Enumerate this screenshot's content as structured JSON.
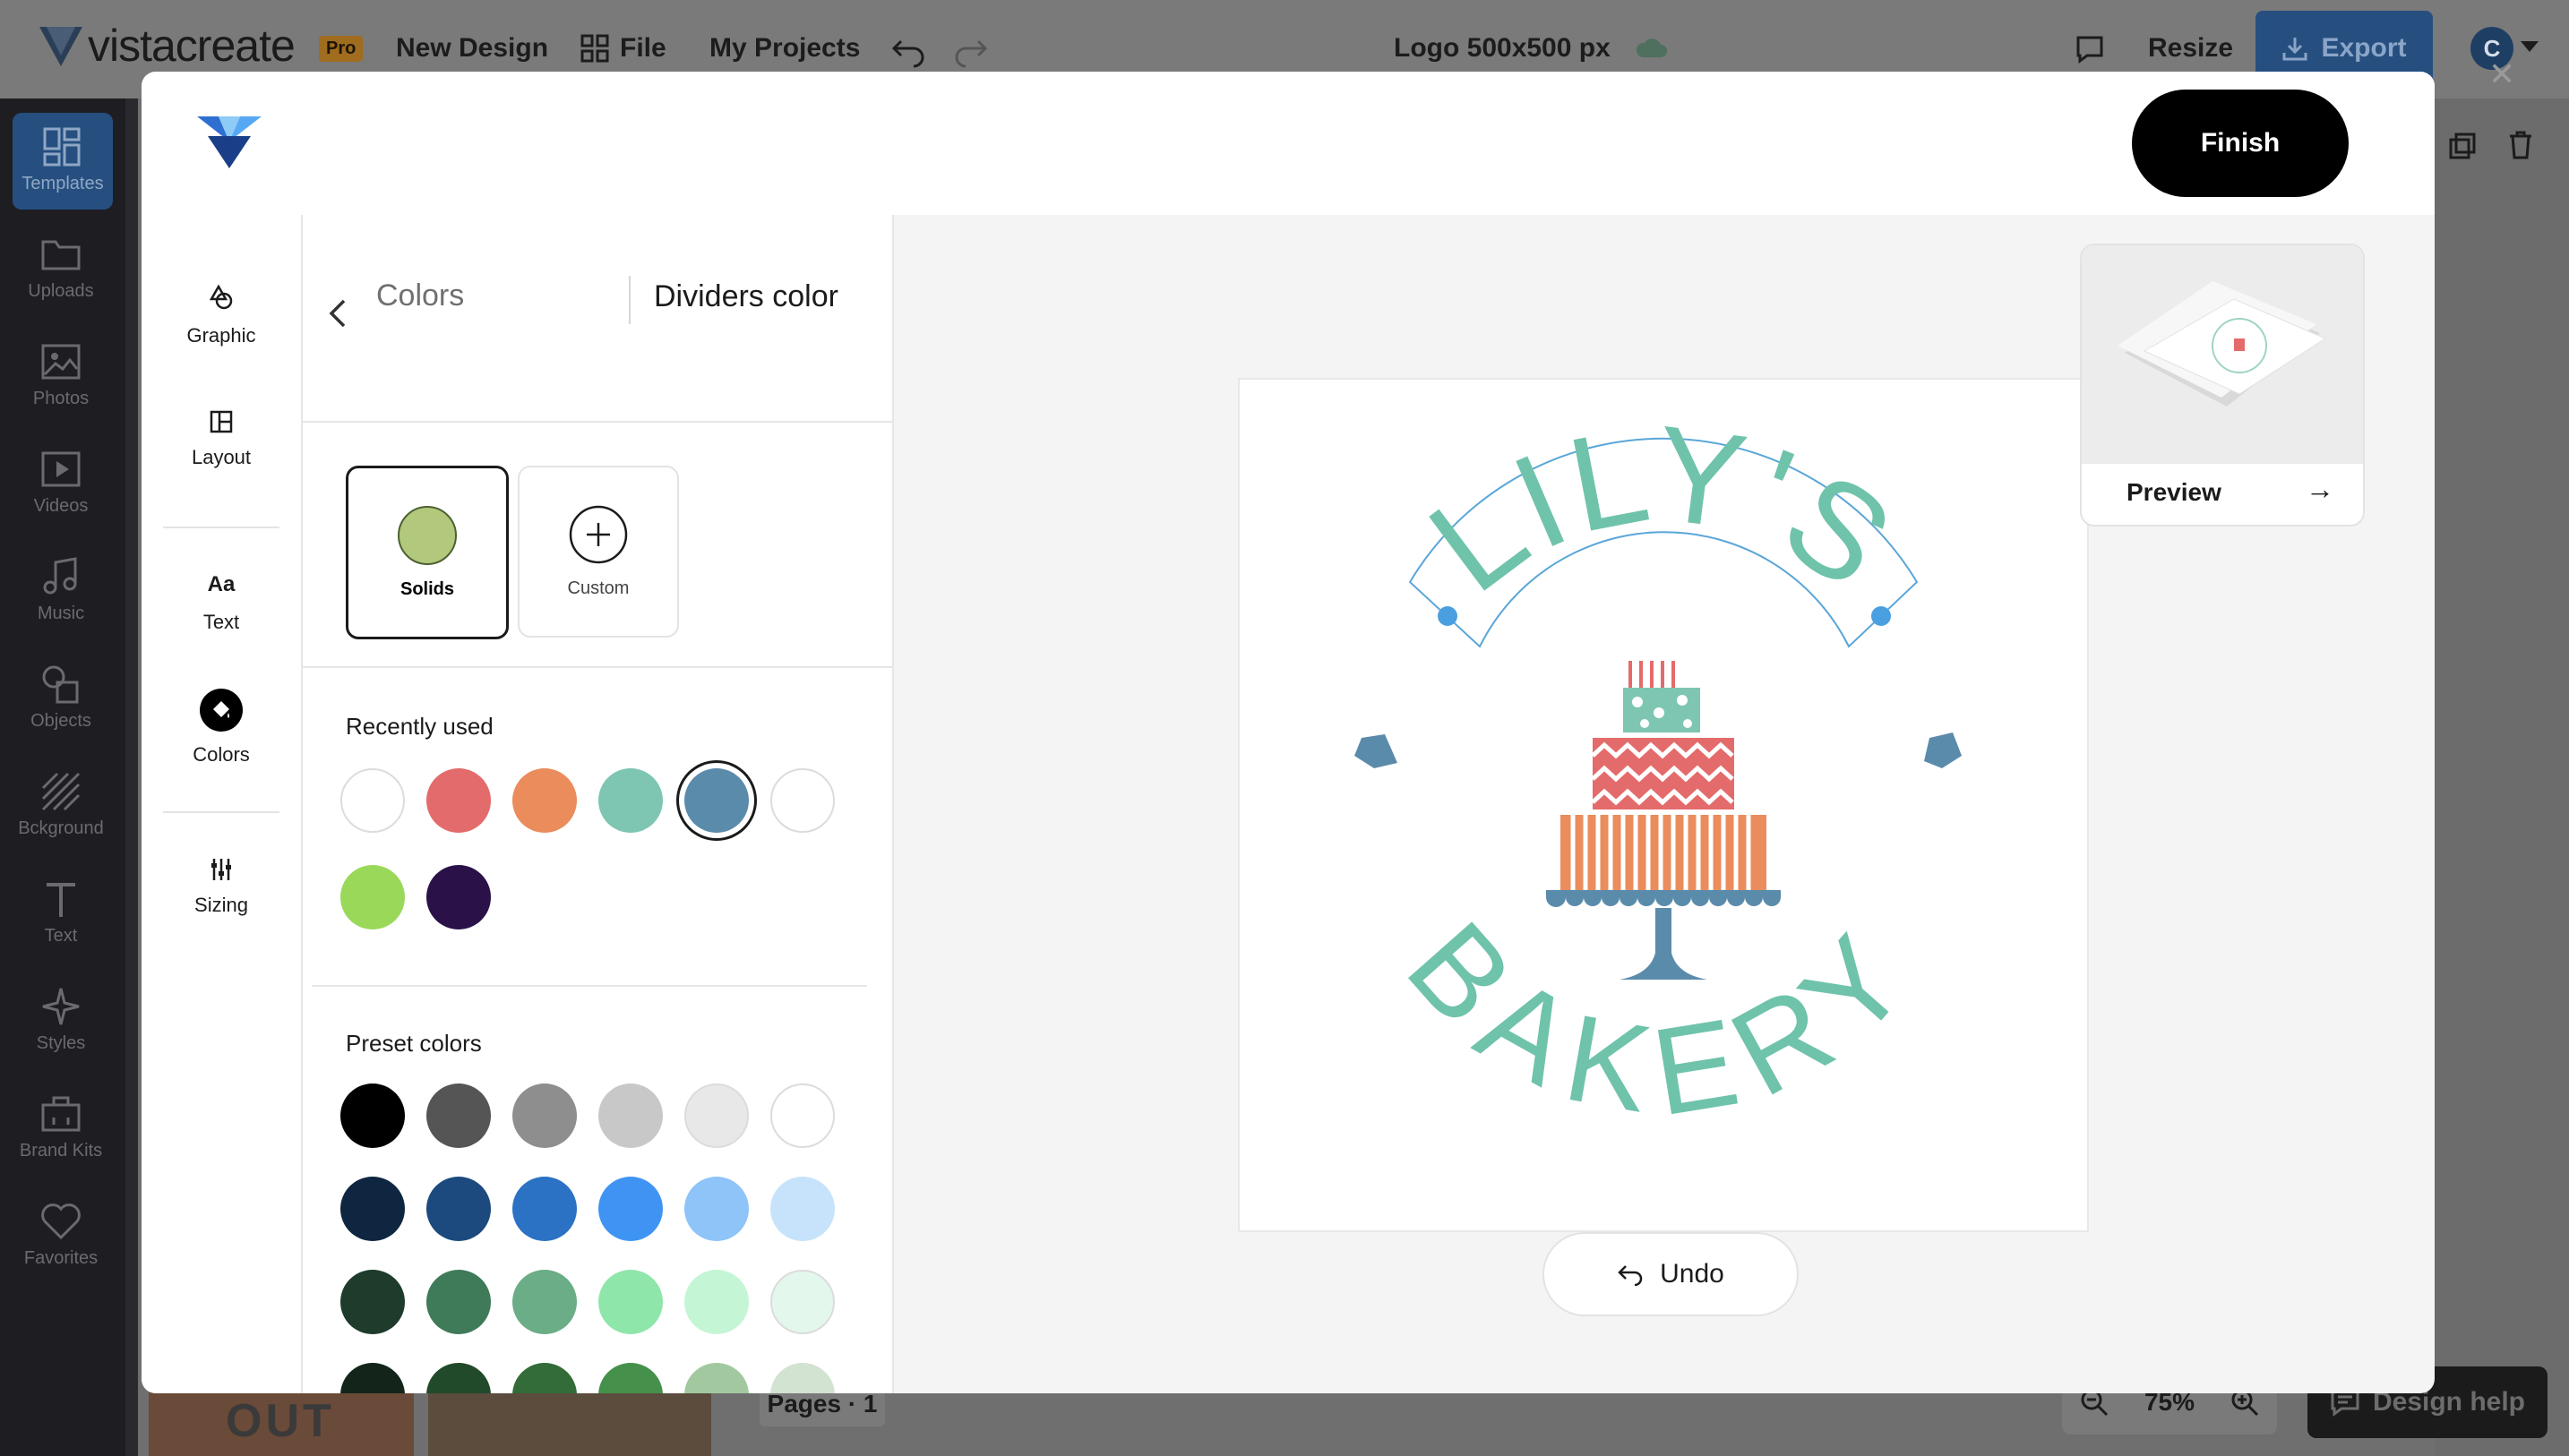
{
  "topbar": {
    "brand": "vistacreate",
    "pro_badge": "Pro",
    "new_design": "New Design",
    "file": "File",
    "my_projects": "My Projects",
    "doc_title": "Logo 500x500 px",
    "resize": "Resize",
    "export": "Export",
    "avatar_initial": "C"
  },
  "sidebar": {
    "items": [
      {
        "label": "Templates",
        "icon": "templates-icon"
      },
      {
        "label": "Uploads",
        "icon": "folder-icon"
      },
      {
        "label": "Photos",
        "icon": "photo-icon"
      },
      {
        "label": "Videos",
        "icon": "video-icon"
      },
      {
        "label": "Music",
        "icon": "music-icon"
      },
      {
        "label": "Objects",
        "icon": "objects-icon"
      },
      {
        "label": "Bckground",
        "icon": "background-icon"
      },
      {
        "label": "Text",
        "icon": "text-icon"
      },
      {
        "label": "Styles",
        "icon": "styles-icon"
      },
      {
        "label": "Brand Kits",
        "icon": "brand-kit-icon"
      },
      {
        "label": "Favorites",
        "icon": "heart-icon"
      }
    ]
  },
  "bottom": {
    "pages": "Pages · 1",
    "zoom": "75%",
    "design_help": "Design help",
    "thumb_text": "OUT"
  },
  "modal": {
    "finish": "Finish",
    "tools": [
      {
        "label": "Graphic",
        "icon": "graphic-icon"
      },
      {
        "label": "Layout",
        "icon": "layout-icon"
      },
      {
        "label": "Text",
        "icon": "text-aa-icon",
        "glyph": "Aa"
      },
      {
        "label": "Colors",
        "icon": "colors-icon"
      },
      {
        "label": "Sizing",
        "icon": "sizing-icon"
      }
    ],
    "panel": {
      "breadcrumb_parent": "Colors",
      "breadcrumb_current": "Dividers color",
      "type_solids": "Solids",
      "type_custom": "Custom",
      "solids_color": "#b2c97d",
      "recently_used_label": "Recently used",
      "recently_used": [
        "#ffffff",
        "#e46b6b",
        "#ea8c5c",
        "#7ec6b1",
        "#5b8bab",
        "#ffffff",
        "#9ad85a",
        "#2a1248"
      ],
      "selected_index": 4,
      "preset_label": "Preset colors",
      "preset_colors": [
        [
          "#000000",
          "#555555",
          "#8e8e8e",
          "#c8c8c8",
          "#e8e8e8",
          "#ffffff"
        ],
        [
          "#0f2640",
          "#1c4a7e",
          "#2b72c4",
          "#3f94f3",
          "#8ec4f8",
          "#c7e3fb"
        ],
        [
          "#1e3b2c",
          "#3f7a59",
          "#6aad86",
          "#8ee6aa",
          "#c4f5d5",
          "#e3f7ec"
        ],
        [
          "#13251a",
          "#214a2b",
          "#336c38",
          "#45914b",
          "#a2c89f",
          "#d2e3d1"
        ]
      ]
    },
    "canvas": {
      "logo_top_text": "LILY'S",
      "logo_bottom_text": "BAKERY",
      "teal": "#6fc3ab",
      "divider_blue": "#5b8bab"
    },
    "undo": "Undo",
    "preview": "Preview",
    "preview_arrow": "→"
  }
}
